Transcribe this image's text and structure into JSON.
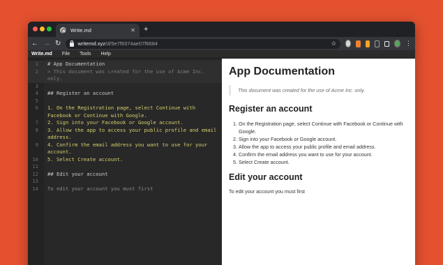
{
  "browser": {
    "tab_title": "Write.md",
    "url_host": "writemd.xyz",
    "url_path": "/d/5e7f9374ae07f6684"
  },
  "app_menu": {
    "brand": "Write.md",
    "items": [
      "File",
      "Tools",
      "Help"
    ]
  },
  "editor": {
    "lines": [
      {
        "n": "1",
        "text": "# App Documentation"
      },
      {
        "n": "2",
        "text": "> This document was created for the use of Acme Inc."
      },
      {
        "n": "",
        "text": "only."
      },
      {
        "n": "3",
        "text": ""
      },
      {
        "n": "4",
        "text": "## Register an account"
      },
      {
        "n": "5",
        "text": ""
      },
      {
        "n": "6",
        "text": "1. On the Registration page, select Continue with"
      },
      {
        "n": "",
        "text": "Facebook or Continue with Google."
      },
      {
        "n": "7",
        "text": "2. Sign into your Facebook or Google account."
      },
      {
        "n": "8",
        "text": "3. Allow the app to access your public profile and email"
      },
      {
        "n": "",
        "text": "address."
      },
      {
        "n": "9",
        "text": "4. Confirm the email address you want to use for your"
      },
      {
        "n": "",
        "text": "account."
      },
      {
        "n": "10",
        "text": "5. Select Create account."
      },
      {
        "n": "11",
        "text": ""
      },
      {
        "n": "12",
        "text": "## Edit your account"
      },
      {
        "n": "13",
        "text": ""
      },
      {
        "n": "14",
        "text": "To edit your account you must first"
      }
    ]
  },
  "preview": {
    "title": "App Documentation",
    "quote": "This document was created for the use of Acme Inc. only.",
    "section1_title": "Register an account",
    "steps": [
      "On the Registration page, select Continue with Facebook or Continue with Google.",
      "Sign into your Facebook or Google account.",
      "Allow the app to access your public profile and email address.",
      "Confirm the email address you want to use for your account.",
      "Select Create account."
    ],
    "section2_title": "Edit your account",
    "section2_text": "To edit your account you must first"
  }
}
